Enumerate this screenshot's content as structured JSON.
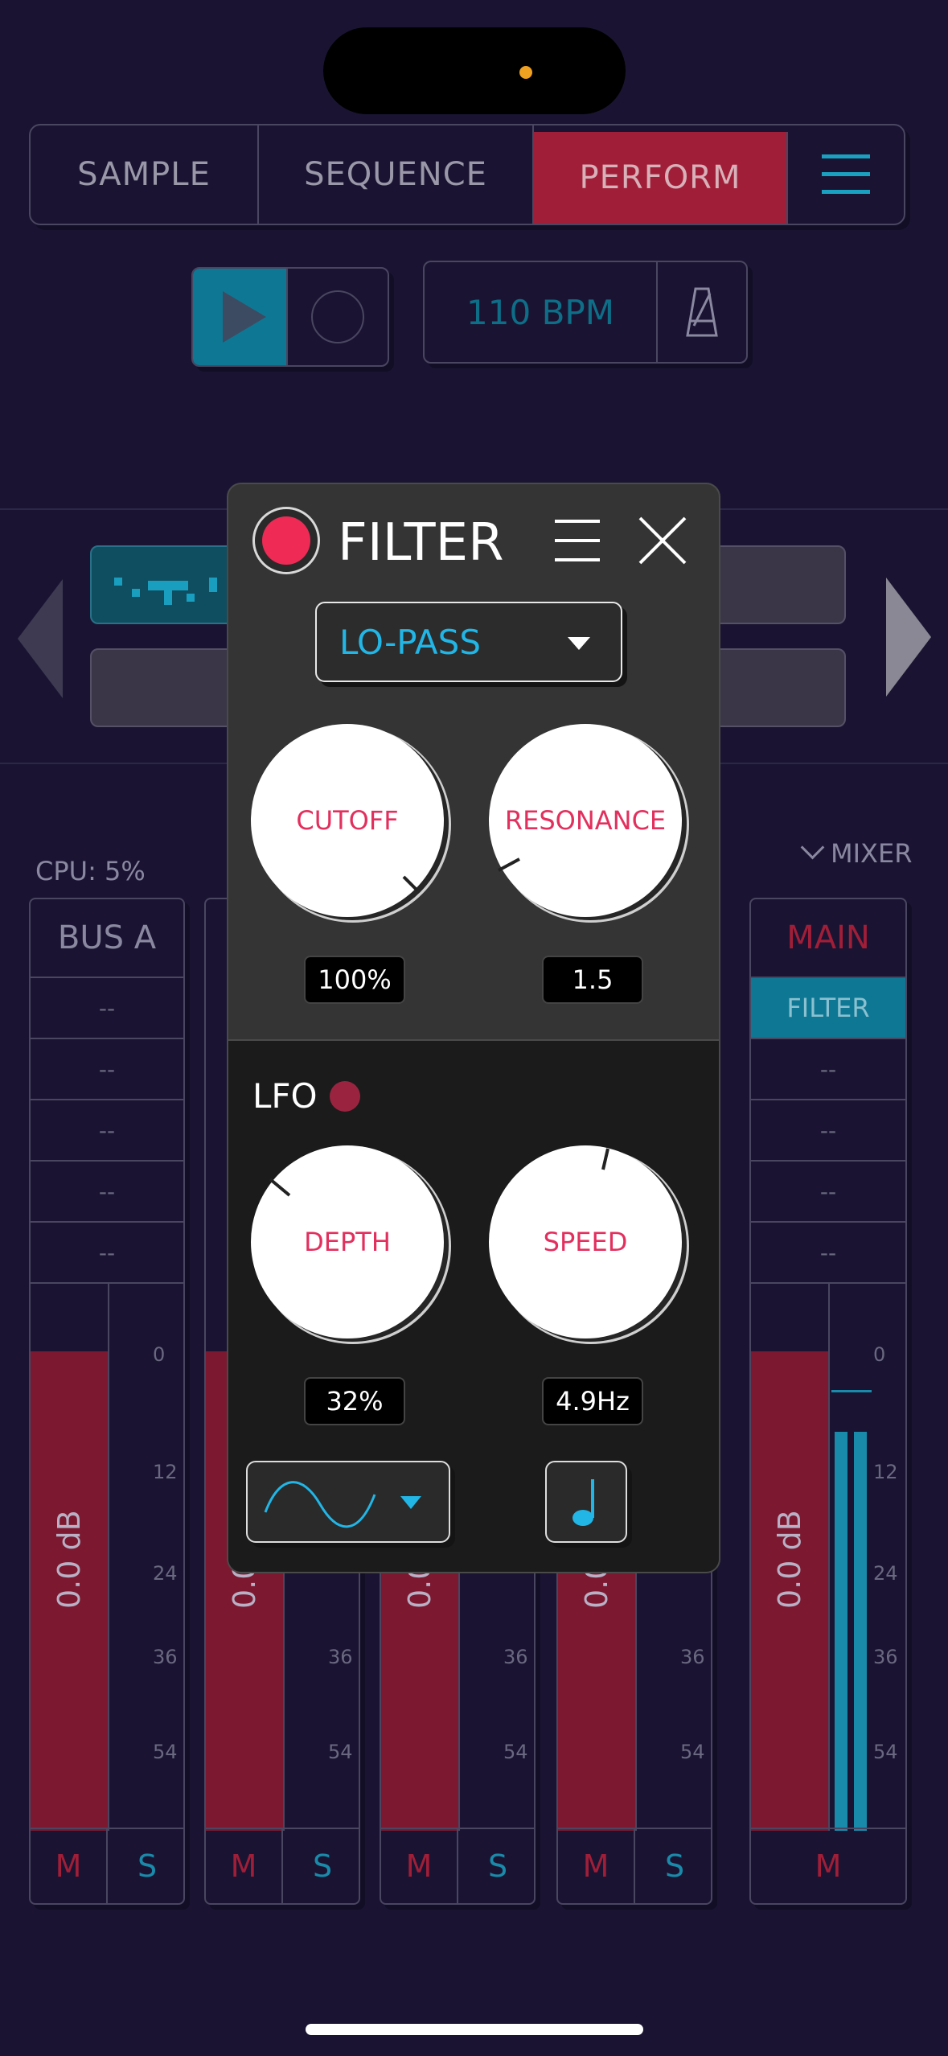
{
  "tabs": [
    "SAMPLE",
    "SEQUENCE",
    "PERFORM"
  ],
  "transport": {
    "bpm": "110 BPM"
  },
  "status": {
    "cpu": "CPU: 5%",
    "mixer_toggle": "MIXER"
  },
  "channels": [
    {
      "name": "BUS A",
      "slots": [
        "--",
        "--",
        "--",
        "--",
        "--"
      ],
      "db": "0.0 dB",
      "mute": "M",
      "solo": "S"
    },
    {
      "name": "",
      "slots": [
        "",
        "",
        "",
        "",
        ""
      ],
      "db": "0.0 dB",
      "mute": "M",
      "solo": "S"
    },
    {
      "name": "",
      "slots": [
        "",
        "",
        "",
        "",
        ""
      ],
      "db": "0.0 dB",
      "mute": "M",
      "solo": "S"
    },
    {
      "name": "",
      "slots": [
        "",
        "",
        "",
        "",
        ""
      ],
      "db": "0.0 dB",
      "mute": "M",
      "solo": "S"
    },
    {
      "name": "MAIN",
      "slots": [
        "FILTER",
        "--",
        "--",
        "--",
        "--"
      ],
      "db": "0.0 dB",
      "mute": "M"
    }
  ],
  "meter_ticks": [
    "0",
    "12",
    "24",
    "36",
    "54"
  ],
  "filter": {
    "title": "FILTER",
    "type": "LO-PASS",
    "cutoff": {
      "label": "CUTOFF",
      "value": "100%"
    },
    "resonance": {
      "label": "RESONANCE",
      "value": "1.5"
    },
    "lfo_label": "LFO",
    "depth": {
      "label": "DEPTH",
      "value": "32%"
    },
    "speed": {
      "label": "SPEED",
      "value": "4.9Hz"
    }
  },
  "colors": {
    "background": "#1a1432",
    "accent_red": "#a01e38",
    "accent_teal": "#0e7894",
    "filter_blue": "#22b6e6",
    "knob_text": "#e2305e"
  }
}
